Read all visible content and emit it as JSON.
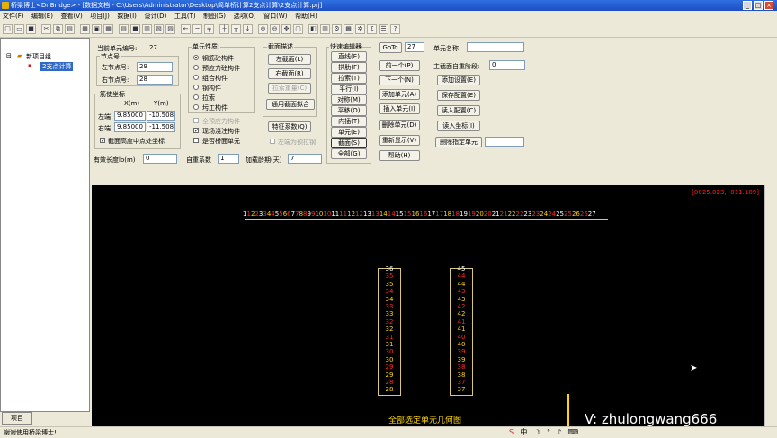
{
  "window": {
    "title": "桥梁博士<Dr.Bridge> - [数据文档 - C:\\Users\\Administrator\\Desktop\\简单桥计算2支点计算\\2支点计算.prj]",
    "min": "_",
    "max": "□",
    "close": "×"
  },
  "menu": [
    "文件(F)",
    "编辑(E)",
    "查看(V)",
    "项目(J)",
    "数据(I)",
    "设计(D)",
    "工具(T)",
    "制图(G)",
    "选项(O)",
    "窗口(W)",
    "帮助(H)"
  ],
  "tree": {
    "root": "新项目组",
    "child": "2支点计算"
  },
  "tab_project": "项目",
  "status_text": "谢谢使用桥梁博士!",
  "form": {
    "cur_elem_label": "当前单元编号:",
    "cur_elem": "27",
    "node_group": "节点号",
    "left_node_label": "左节点号:",
    "left_node": "29",
    "right_node_label": "右节点号:",
    "right_node": "28",
    "coord_group": "筋使坐标",
    "x_head": "X(m)",
    "y_head": "Y(m)",
    "left_end": "左端",
    "left_x": "9.85000",
    "left_y": "-10.508",
    "right_end": "右端",
    "right_x": "9.85000",
    "right_y": "-11.508",
    "section_center_chk": "截面高度中点处坐标",
    "eff_len_label": "有效长度lo(m)",
    "eff_len": "0",
    "self_wt_label": "自重系数",
    "self_wt": "1",
    "load_age_label": "加载龄期(天)",
    "load_age": "7"
  },
  "elem_type": {
    "group": "单元性质:",
    "options": [
      "钢筋砼构件",
      "预应力砼构件",
      "组合构件",
      "钢构件",
      "拉索",
      "圬工构件"
    ],
    "selected": "钢筋砼构件",
    "chk_full_prestress": "全预应力构件",
    "chk_cast_in_place": "现场浇注构件",
    "chk_bridge_deck": "是否桥面单元"
  },
  "section_desc": {
    "group": "截面描述",
    "left_btn": "左截面(L)",
    "right_btn": "右截面(R)",
    "copy_btn": "拉索重量(C)",
    "general_btn": "通用截面拟合",
    "feature_btn": "特征系数(Q)",
    "chk_left_as_prestress": "左端为预拉钢"
  },
  "quick_edit": {
    "group": "快速编辑器",
    "buttons": [
      "直线(E)",
      "拱肋(F)",
      "拉索(T)",
      "平行(I)",
      "对称(M)",
      "平移(O)",
      "内插(T)",
      "单元(E)",
      "截面(S)",
      "全部(G)"
    ]
  },
  "nav": {
    "goto_btn": "GoTo",
    "goto_val": "27",
    "prev_btn": "前一个(P)",
    "next_btn": "下一个(N)",
    "add_btn": "添加单元(A)",
    "insert_btn": "插入单元(I)",
    "delete_btn": "删除单元(D)",
    "refresh_btn": "重新显示(V)",
    "help_btn": "帮助(H)"
  },
  "right_col": {
    "elem_name_label": "单元名称",
    "elem_name": "",
    "main_section_label": "主截面自重阶段:",
    "main_section": "0",
    "add_setting_btn": "添加设置(E)",
    "save_config_btn": "保存配置(E)",
    "read_config_btn": "读入配置(C)",
    "read_coord_btn": "读入坐标(I)",
    "delete_sel_btn": "删除指定单元",
    "delete_sel_val": ""
  },
  "canvas": {
    "coord_readout": "[0025.023, -011.189]",
    "nodes_top": [
      "1",
      "1",
      "2",
      "2",
      "3",
      "3",
      "4",
      "4",
      "5",
      "5",
      "6",
      "6",
      "7",
      "7",
      "8",
      "8",
      "9",
      "9",
      "10",
      "10",
      "11",
      "11",
      "12",
      "12",
      "13",
      "13",
      "14",
      "14",
      "15",
      "15",
      "16",
      "16",
      "17",
      "17",
      "18",
      "18",
      "19",
      "19",
      "20",
      "20",
      "21",
      "21",
      "22",
      "22",
      "23",
      "23",
      "24",
      "24",
      "25",
      "25",
      "26",
      "26",
      "27"
    ],
    "left_column": [
      "36",
      "35",
      "35",
      "34",
      "34",
      "33",
      "33",
      "32",
      "32",
      "31",
      "31",
      "30",
      "30",
      "29",
      "29",
      "28",
      "28"
    ],
    "right_column": [
      "45",
      "44",
      "44",
      "43",
      "43",
      "42",
      "42",
      "41",
      "41",
      "40",
      "40",
      "39",
      "39",
      "38",
      "38",
      "37",
      "37"
    ],
    "caption": "全部选定单元几何图",
    "watermark": "V: zhulongwang666",
    "colors": {
      "white": "#ffffff",
      "yellow": "#ffd700",
      "red": "#ff2a2a",
      "box": "#d8c878"
    }
  }
}
